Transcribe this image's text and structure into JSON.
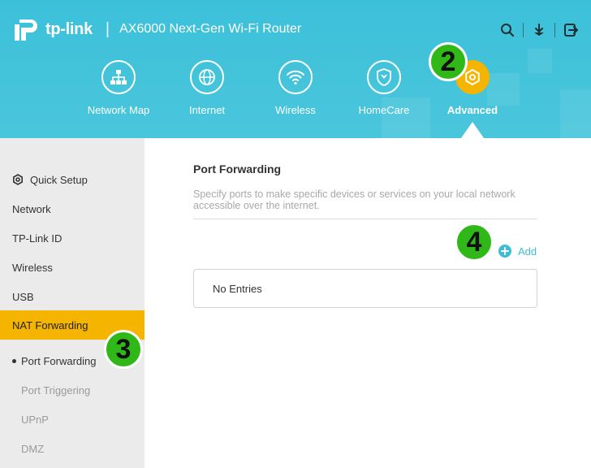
{
  "header": {
    "brand": "tp-link",
    "separator": "|",
    "model": "AX6000 Next-Gen Wi-Fi Router",
    "actions": [
      {
        "name": "search-icon"
      },
      {
        "name": "download-icon"
      },
      {
        "name": "logout-icon"
      }
    ],
    "nav": [
      {
        "label": "Network Map",
        "icon": "network-map-icon"
      },
      {
        "label": "Internet",
        "icon": "globe-icon"
      },
      {
        "label": "Wireless",
        "icon": "wifi-icon"
      },
      {
        "label": "HomeCare",
        "icon": "shield-icon"
      },
      {
        "label": "Advanced",
        "icon": "gear-icon",
        "active": true
      }
    ]
  },
  "badges": [
    "2",
    "3",
    "4"
  ],
  "sidebar": {
    "items": [
      {
        "label": "Quick Setup",
        "icon": "gear-icon"
      },
      {
        "label": "Network"
      },
      {
        "label": "TP-Link ID"
      },
      {
        "label": "Wireless"
      },
      {
        "label": "USB"
      },
      {
        "label": "NAT Forwarding",
        "active": true
      }
    ],
    "subitems": [
      {
        "label": "Port Forwarding",
        "current": true
      },
      {
        "label": "Port Triggering"
      },
      {
        "label": "UPnP"
      },
      {
        "label": "DMZ"
      }
    ]
  },
  "main": {
    "title": "Port Forwarding",
    "description": "Specify ports to make specific devices or services on your local network accessible over the internet.",
    "add_label": "Add",
    "empty_text": "No Entries"
  },
  "colors": {
    "header": "#3cc0d9",
    "accent": "#3cbcd7",
    "active": "#f4b400",
    "badge": "#2fb818"
  }
}
